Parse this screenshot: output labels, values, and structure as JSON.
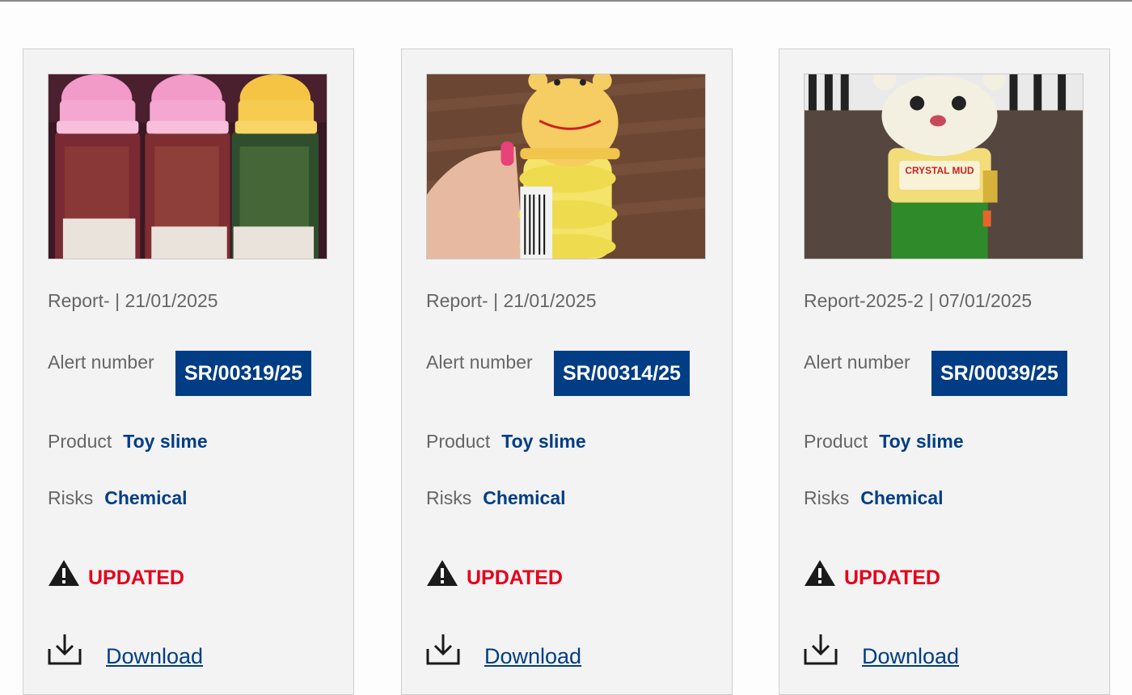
{
  "cards": [
    {
      "report": "Report- | 21/01/2025",
      "alert_label": "Alert number",
      "alert_number": "SR/00319/25",
      "product_label": "Product",
      "product": "Toy slime",
      "risks_label": "Risks",
      "risks": "Chemical",
      "status": "UPDATED",
      "download": "Download",
      "thumb_icon": "photo-toy-slime-bottles-pink-yellow-caps"
    },
    {
      "report": "Report- | 21/01/2025",
      "alert_label": "Alert number",
      "alert_number": "SR/00314/25",
      "product_label": "Product",
      "product": "Toy slime",
      "risks_label": "Risks",
      "risks": "Chemical",
      "status": "UPDATED",
      "download": "Download",
      "thumb_icon": "photo-yellow-bear-slime-bottle-in-hand"
    },
    {
      "report": "Report-2025-2 | 07/01/2025",
      "alert_label": "Alert number",
      "alert_number": "SR/00039/25",
      "product_label": "Product",
      "product": "Toy slime",
      "risks_label": "Risks",
      "risks": "Chemical",
      "status": "UPDATED",
      "download": "Download",
      "thumb_icon": "photo-crystal-mud-green-slime-jar",
      "thumb_label": "CRYSTAL MUD"
    }
  ],
  "colors": {
    "accent": "#003d85",
    "status": "#e4001b",
    "card_bg": "#f3f3f3",
    "muted_text": "#666666"
  }
}
